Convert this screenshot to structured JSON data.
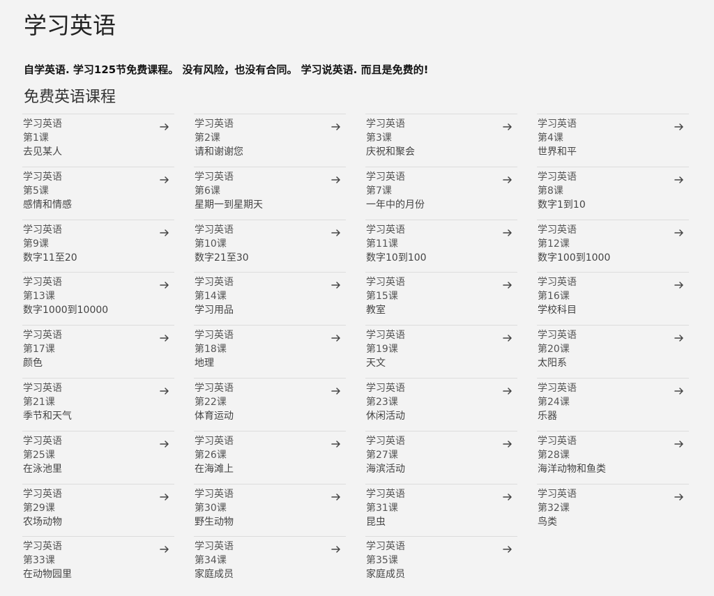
{
  "page": {
    "title": "学习英语",
    "intro": "自学英语. 学习125节免费课程。 没有风险，也没有合同。 学习说英语. 而且是免费的!",
    "section_title": "免费英语课程"
  },
  "lessons": [
    {
      "prefix": "学习英语",
      "number": "第1课",
      "name": "去见某人"
    },
    {
      "prefix": "学习英语",
      "number": "第2课",
      "name": "请和谢谢您"
    },
    {
      "prefix": "学习英语",
      "number": "第3课",
      "name": "庆祝和聚会"
    },
    {
      "prefix": "学习英语",
      "number": "第4课",
      "name": "世界和平"
    },
    {
      "prefix": "学习英语",
      "number": "第5课",
      "name": "感情和情感"
    },
    {
      "prefix": "学习英语",
      "number": "第6课",
      "name": "星期一到星期天"
    },
    {
      "prefix": "学习英语",
      "number": "第7课",
      "name": "一年中的月份"
    },
    {
      "prefix": "学习英语",
      "number": "第8课",
      "name": "数字1到10"
    },
    {
      "prefix": "学习英语",
      "number": "第9课",
      "name": "数字11至20"
    },
    {
      "prefix": "学习英语",
      "number": "第10课",
      "name": "数字21至30"
    },
    {
      "prefix": "学习英语",
      "number": "第11课",
      "name": "数字10到100"
    },
    {
      "prefix": "学习英语",
      "number": "第12课",
      "name": "数字100到1000"
    },
    {
      "prefix": "学习英语",
      "number": "第13课",
      "name": "数字1000到10000"
    },
    {
      "prefix": "学习英语",
      "number": "第14课",
      "name": "学习用品"
    },
    {
      "prefix": "学习英语",
      "number": "第15课",
      "name": "教室"
    },
    {
      "prefix": "学习英语",
      "number": "第16课",
      "name": "学校科目"
    },
    {
      "prefix": "学习英语",
      "number": "第17课",
      "name": "颜色"
    },
    {
      "prefix": "学习英语",
      "number": "第18课",
      "name": "地理"
    },
    {
      "prefix": "学习英语",
      "number": "第19课",
      "name": "天文"
    },
    {
      "prefix": "学习英语",
      "number": "第20课",
      "name": "太阳系"
    },
    {
      "prefix": "学习英语",
      "number": "第21课",
      "name": "季节和天气"
    },
    {
      "prefix": "学习英语",
      "number": "第22课",
      "name": "体育运动"
    },
    {
      "prefix": "学习英语",
      "number": "第23课",
      "name": "休闲活动"
    },
    {
      "prefix": "学习英语",
      "number": "第24课",
      "name": "乐器"
    },
    {
      "prefix": "学习英语",
      "number": "第25课",
      "name": "在泳池里"
    },
    {
      "prefix": "学习英语",
      "number": "第26课",
      "name": "在海滩上"
    },
    {
      "prefix": "学习英语",
      "number": "第27课",
      "name": "海滨活动"
    },
    {
      "prefix": "学习英语",
      "number": "第28课",
      "name": "海洋动物和鱼类"
    },
    {
      "prefix": "学习英语",
      "number": "第29课",
      "name": "农场动物"
    },
    {
      "prefix": "学习英语",
      "number": "第30课",
      "name": "野生动物"
    },
    {
      "prefix": "学习英语",
      "number": "第31课",
      "name": "昆虫"
    },
    {
      "prefix": "学习英语",
      "number": "第32课",
      "name": "鸟类"
    },
    {
      "prefix": "学习英语",
      "number": "第33课",
      "name": "在动物园里"
    },
    {
      "prefix": "学习英语",
      "number": "第34课",
      "name": "家庭成员"
    },
    {
      "prefix": "学习英语",
      "number": "第35课",
      "name": "家庭成员"
    }
  ],
  "icons": {
    "lesson_arrow": "arrow-right-icon"
  },
  "colors": {
    "background": "#f3f3f3",
    "divider": "#dcdcdc",
    "text": "#555555"
  }
}
